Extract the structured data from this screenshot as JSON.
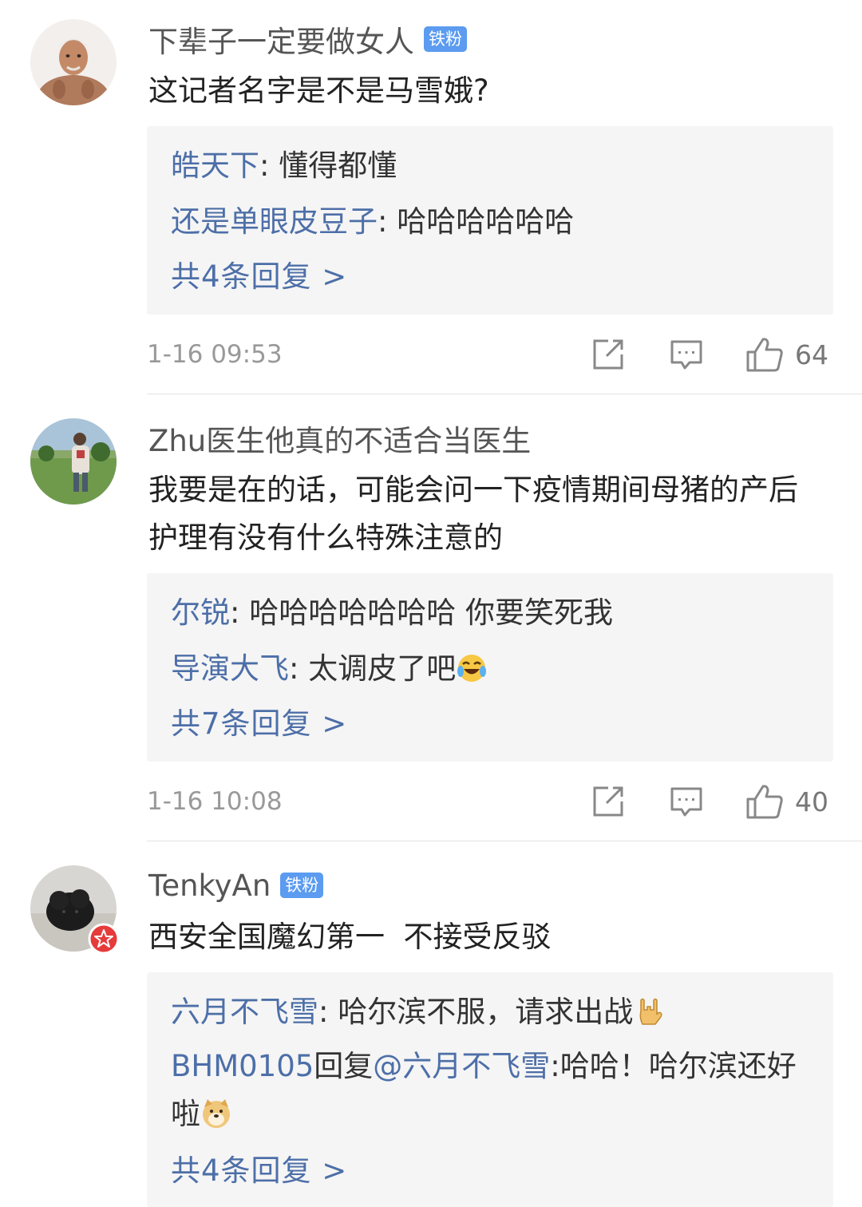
{
  "comments": [
    {
      "username": "下辈子一定要做女人",
      "badge": "铁粉",
      "text": "这记者名字是不是马雪娥?",
      "replies": [
        {
          "user": "皓天下",
          "sep": ": ",
          "text": "懂得都懂"
        },
        {
          "user": "还是单眼皮豆子",
          "sep": ": ",
          "text": "哈哈哈哈哈哈"
        }
      ],
      "more_replies": "共4条回复 >",
      "time": "1-16 09:53",
      "likes": "64"
    },
    {
      "username": "Zhu医生他真的不适合当医生",
      "text": "我要是在的话，可能会问一下疫情期间母猪的产后护理有没有什么特殊注意的",
      "replies": [
        {
          "user": "尔锐",
          "sep": ": ",
          "text": "哈哈哈哈哈哈哈 你要笑死我"
        },
        {
          "user": "导演大飞",
          "sep": ": ",
          "text": "太调皮了吧"
        }
      ],
      "more_replies": "共7条回复 >",
      "time": "1-16 10:08",
      "likes": "40"
    },
    {
      "username": "TenkyAn",
      "badge": "铁粉",
      "text": "西安全国魔幻第一  不接受反驳",
      "replies": [
        {
          "user": "六月不飞雪",
          "sep": ": ",
          "text": "哈尔滨不服，请求出战"
        },
        {
          "user": "BHM0105",
          "mid": "回复",
          "mention": "@六月不飞雪",
          "text": ":哈哈！哈尔滨还好啦"
        }
      ],
      "more_replies": "共4条回复 >"
    }
  ],
  "icons": {
    "share": "share-icon",
    "comment": "comment-icon",
    "like": "thumbs-up-icon",
    "emoji_laugh": "laughing-crying-emoji-icon",
    "emoji_rock": "rock-hand-emoji-icon",
    "emoji_doge": "doge-emoji-icon",
    "verified": "verified-star-icon"
  },
  "colors": {
    "link": "#4d6fa8",
    "badge": "#5b9bf0",
    "reply_bg": "#f5f5f5",
    "muted": "#999999"
  }
}
